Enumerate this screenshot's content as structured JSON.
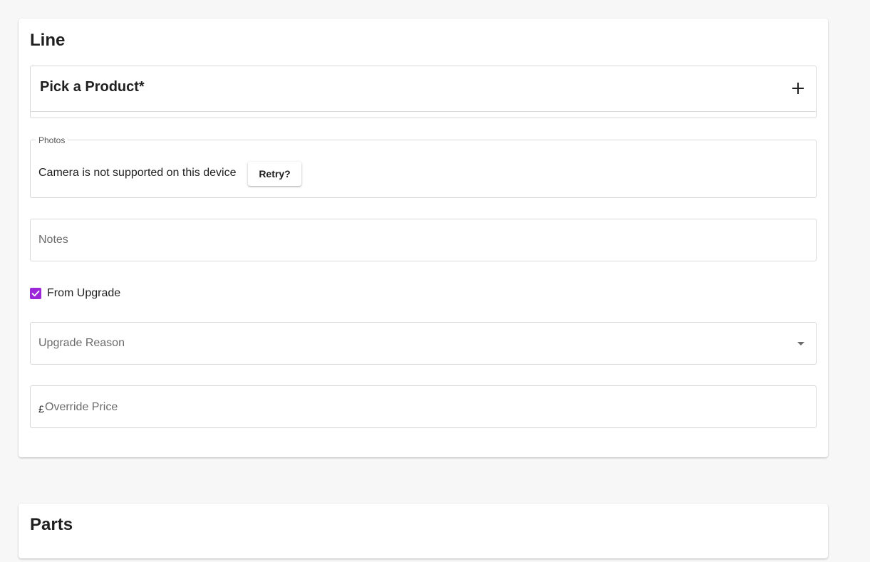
{
  "line_section": {
    "title": "Line",
    "product_picker": {
      "title": "Pick a Product*",
      "expand_icon": "plus-icon"
    },
    "photos": {
      "legend": "Photos",
      "message": "Camera is not supported on this device",
      "retry_label": "Retry?"
    },
    "notes": {
      "placeholder": "Notes",
      "value": ""
    },
    "from_upgrade": {
      "label": "From Upgrade",
      "checked": true
    },
    "upgrade_reason": {
      "placeholder": "Upgrade Reason",
      "selected": "",
      "icon": "caret-down-icon"
    },
    "override_price": {
      "currency_symbol": "£",
      "placeholder": "Override Price",
      "value": ""
    }
  },
  "parts_section": {
    "title": "Parts"
  },
  "colors": {
    "page_background": "#f7f7f7",
    "card_background": "#ffffff",
    "checkbox_accent": "#9c27d9",
    "border": "#d9d9d9"
  }
}
